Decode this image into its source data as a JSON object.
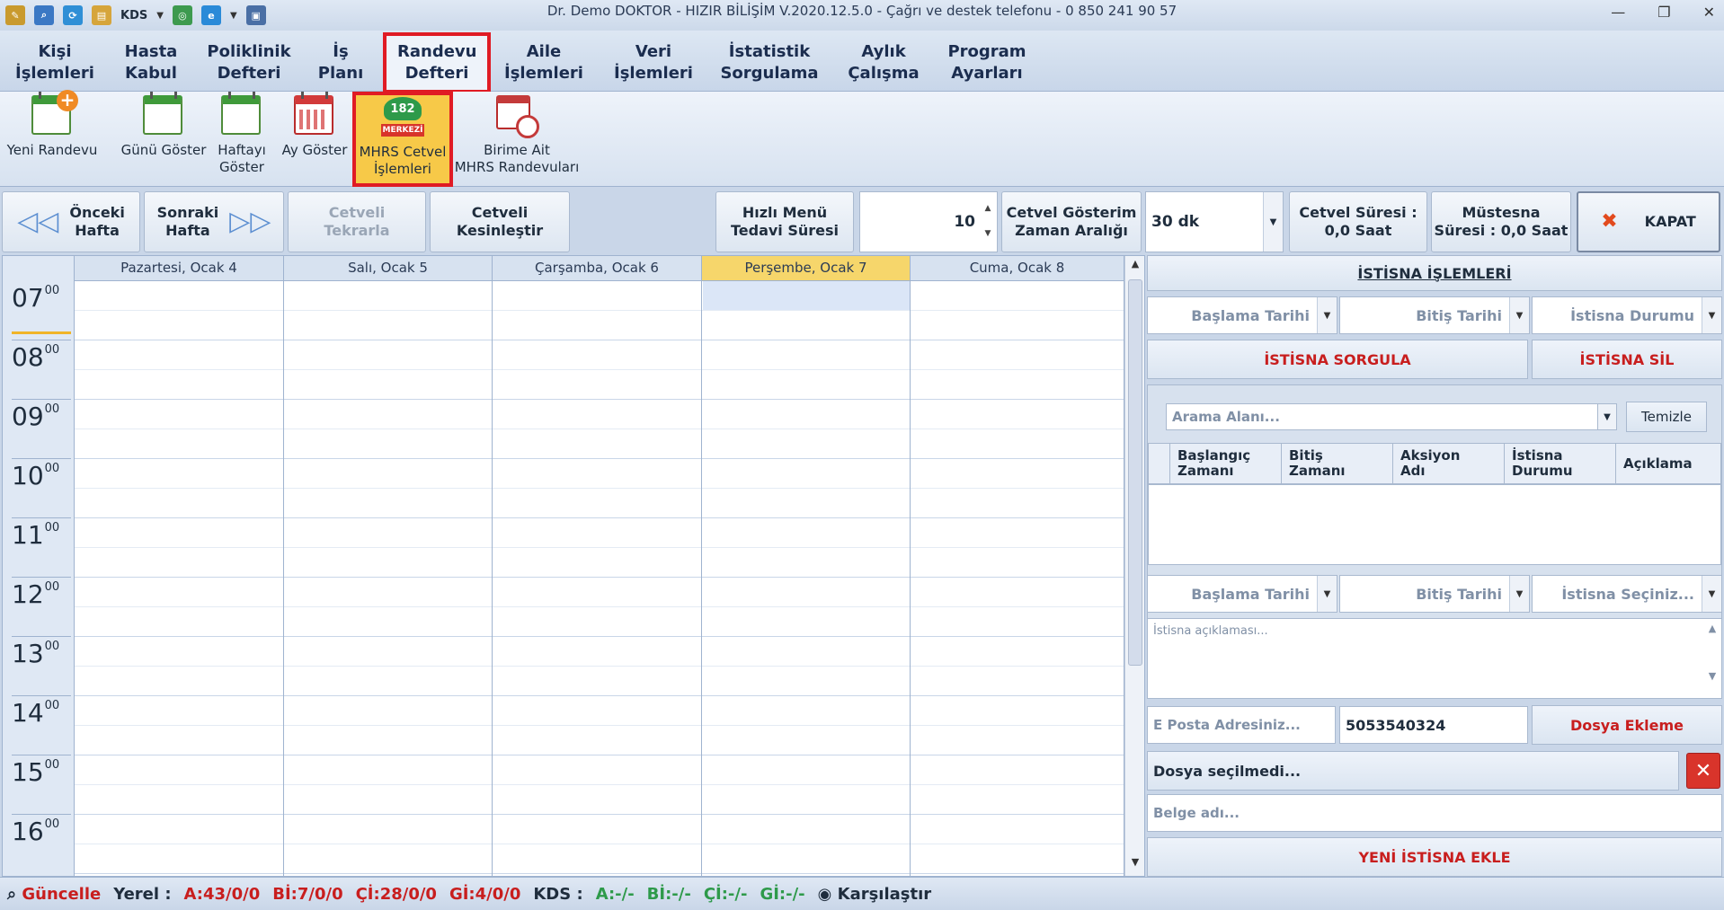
{
  "window": {
    "title": "Dr. Demo DOKTOR - HIZIR BİLİŞİM V.2020.12.5.0 - Çağrı ve destek telefonu - 0 850 241 90 57",
    "qat_kds": "KDS"
  },
  "menu": {
    "items": [
      {
        "line1": "Kişi",
        "line2": "İşlemleri"
      },
      {
        "line1": "Hasta",
        "line2": "Kabul"
      },
      {
        "line1": "Poliklinik",
        "line2": "Defteri"
      },
      {
        "line1": "İş",
        "line2": "Planı"
      },
      {
        "line1": "Randevu",
        "line2": "Defteri"
      },
      {
        "line1": "Aile",
        "line2": "İşlemleri"
      },
      {
        "line1": "Veri",
        "line2": "İşlemleri"
      },
      {
        "line1": "İstatistik",
        "line2": "Sorgulama"
      },
      {
        "line1": "Aylık",
        "line2": "Çalışma"
      },
      {
        "line1": "Program",
        "line2": "Ayarları"
      }
    ],
    "active_index": 4
  },
  "ribbon": {
    "yeni_randevu": "Yeni Randevu",
    "gunu_goster": "Günü Göster",
    "haftayi_line1": "Haftayı",
    "haftayi_line2": "Göster",
    "ay_goster": "Ay Göster",
    "mhrs_line1": "MHRS Cetvel",
    "mhrs_line2": "İşlemleri",
    "mhrs_badge_num": "182",
    "mhrs_badge_text": "MERKEZİ",
    "birime_line1": "Birime Ait",
    "birime_line2": "MHRS Randevuları"
  },
  "toolbar": {
    "onceki_line1": "Önceki",
    "onceki_line2": "Hafta",
    "sonraki_line1": "Sonraki",
    "sonraki_line2": "Hafta",
    "tekrarla_line1": "Cetveli",
    "tekrarla_line2": "Tekrarla",
    "kesinlestir_line1": "Cetveli",
    "kesinlestir_line2": "Kesinleştir",
    "hizli_line1": "Hızlı Menü",
    "hizli_line2": "Tedavi Süresi",
    "tedavi_suresi_value": "10",
    "cetvel_gosterim_line1": "Cetvel Gösterim",
    "cetvel_gosterim_line2": "Zaman Aralığı",
    "zaman_araligi_value": "30 dk",
    "cetvel_suresi_line1": "Cetvel Süresi :",
    "cetvel_suresi_line2": "0,0 Saat",
    "mustesna_line1": "Müstesna",
    "mustesna_line2": "Süresi : 0,0 Saat",
    "kapat": "KAPAT"
  },
  "calendar": {
    "days": [
      "Pazartesi, Ocak 4",
      "Salı, Ocak 5",
      "Çarşamba, Ocak 6",
      "Perşembe, Ocak 7",
      "Cuma, Ocak 8"
    ],
    "today_index": 3,
    "hours": [
      "07",
      "08",
      "09",
      "10",
      "11",
      "12",
      "13",
      "14",
      "15",
      "16"
    ],
    "minutes": "00"
  },
  "istisna": {
    "header": "İSTİSNA İŞLEMLERİ",
    "baslama_tarihi": "Başlama Tarihi",
    "bitis_tarihi": "Bitiş Tarihi",
    "istisna_durumu": "İstisna Durumu",
    "sorgula": "İSTİSNA SORGULA",
    "sil": "İSTİSNA SİL",
    "arama_placeholder": "Arama Alanı...",
    "temizle": "Temizle",
    "columns": [
      {
        "line1": "Başlangıç",
        "line2": "Zamanı"
      },
      {
        "line1": "Bitiş",
        "line2": "Zamanı"
      },
      {
        "line1": "Aksiyon",
        "line2": "Adı"
      },
      {
        "line1": "İstisna",
        "line2": "Durumu"
      },
      {
        "line1": "Açıklama",
        "line2": ""
      }
    ],
    "baslama_tarihi_2": "Başlama Tarihi",
    "bitis_tarihi_2": "Bitiş Tarihi",
    "istisna_seciniz": "İstisna Seçiniz...",
    "aciklama_placeholder": "İstisna açıklaması...",
    "eposta_placeholder": "E Posta Adresiniz...",
    "telefon": "5053540324",
    "dosya_ekleme": "Dosya Ekleme",
    "dosya_secilmedi": "Dosya seçilmedi...",
    "belge_adi_placeholder": "Belge adı...",
    "yeni_istisna": "YENİ İSTİSNA EKLE"
  },
  "statusbar": {
    "guncelle": "Güncelle",
    "yerel": "Yerel :",
    "a": "A:43/0/0",
    "bi": "Bİ:7/0/0",
    "ci": "Çİ:28/0/0",
    "gi": "Gİ:4/0/0",
    "kds": "KDS :",
    "kds_a": "A:-/-",
    "kds_bi": "Bİ:-/-",
    "kds_ci": "Çİ:-/-",
    "kds_gi": "Gİ:-/-",
    "karsilastir": "Karşılaştır"
  },
  "colors": {
    "accent_red": "#e01b24",
    "today_highlight": "#f6d66b",
    "status_green": "#2e9a4a"
  }
}
